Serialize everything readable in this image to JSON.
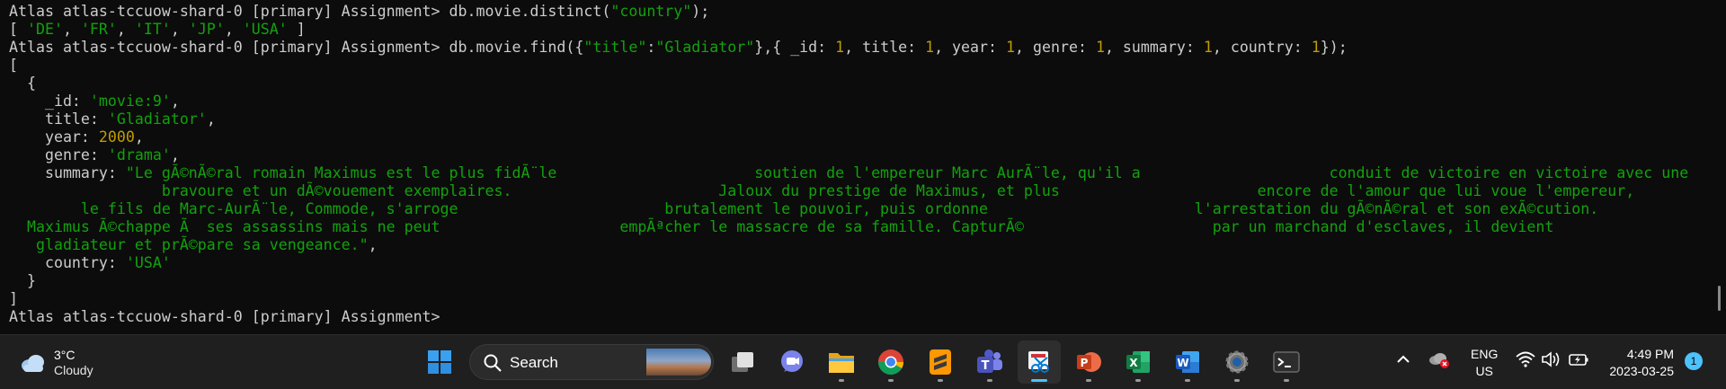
{
  "terminal": {
    "lines": [
      [
        {
          "t": "Atlas atlas-tccuow-shard-0 [primary] Assignment> db.movie.distinct("
        },
        {
          "t": "\"country\"",
          "c": "s"
        },
        {
          "t": ");"
        }
      ],
      [
        {
          "t": "[ "
        },
        {
          "t": "'DE'",
          "c": "s"
        },
        {
          "t": ", "
        },
        {
          "t": "'FR'",
          "c": "s"
        },
        {
          "t": ", "
        },
        {
          "t": "'IT'",
          "c": "s"
        },
        {
          "t": ", "
        },
        {
          "t": "'JP'",
          "c": "s"
        },
        {
          "t": ", "
        },
        {
          "t": "'USA'",
          "c": "s"
        },
        {
          "t": " ]"
        }
      ],
      [
        {
          "t": "Atlas atlas-tccuow-shard-0 [primary] Assignment> db.movie.find({"
        },
        {
          "t": "\"title\"",
          "c": "s"
        },
        {
          "t": ":"
        },
        {
          "t": "\"Gladiator\"",
          "c": "s"
        },
        {
          "t": "},{ _id: "
        },
        {
          "t": "1",
          "c": "n"
        },
        {
          "t": ", title: "
        },
        {
          "t": "1",
          "c": "n"
        },
        {
          "t": ", year: "
        },
        {
          "t": "1",
          "c": "n"
        },
        {
          "t": ", genre: "
        },
        {
          "t": "1",
          "c": "n"
        },
        {
          "t": ", summary: "
        },
        {
          "t": "1",
          "c": "n"
        },
        {
          "t": ", country: "
        },
        {
          "t": "1",
          "c": "n"
        },
        {
          "t": "});"
        }
      ],
      [
        {
          "t": "["
        }
      ],
      [
        {
          "t": "  {"
        }
      ],
      [
        {
          "t": "    _id: "
        },
        {
          "t": "'movie:9'",
          "c": "s"
        },
        {
          "t": ","
        }
      ],
      [
        {
          "t": "    title: "
        },
        {
          "t": "'Gladiator'",
          "c": "s"
        },
        {
          "t": ","
        }
      ],
      [
        {
          "t": "    year: "
        },
        {
          "t": "2000",
          "c": "n"
        },
        {
          "t": ","
        }
      ],
      [
        {
          "t": "    genre: "
        },
        {
          "t": "'drama'",
          "c": "s"
        },
        {
          "t": ","
        }
      ],
      [
        {
          "t": "    summary: "
        },
        {
          "t": "\"Le gÃ©nÃ©ral romain Maximus est le plus fidÃ¨le                      soutien de l'empereur Marc AurÃ¨le, qu'il a                     conduit de victoire en victoire avec une",
          "c": "s"
        }
      ],
      [
        {
          "t": "                 bravoure et un dÃ©vouement exemplaires.                       Jaloux du prestige de Maximus, et plus                      encore de l'amour que lui voue l'empereur,",
          "c": "s"
        }
      ],
      [
        {
          "t": "        le fils de Marc-AurÃ¨le, Commode, s'arroge                       brutalement le pouvoir, puis ordonne                       l'arrestation du gÃ©nÃ©ral et son exÃ©cution.",
          "c": "s"
        }
      ],
      [
        {
          "t": "  Maximus Ã©chappe Ã  ses assassins mais ne peut                    empÃªcher le massacre de sa famille. CapturÃ©                     par un marchand d'esclaves, il devient",
          "c": "s"
        }
      ],
      [
        {
          "t": "   gladiateur et prÃ©pare sa vengeance.\"",
          "c": "s"
        },
        {
          "t": ","
        }
      ],
      [
        {
          "t": "    country: "
        },
        {
          "t": "'USA'",
          "c": "s"
        }
      ],
      [
        {
          "t": "  }"
        }
      ],
      [
        {
          "t": "]"
        }
      ],
      [
        {
          "t": "Atlas atlas-tccuow-shard-0 [primary] Assignment>"
        }
      ]
    ]
  },
  "taskbar": {
    "weather": {
      "temp": "3°C",
      "condition": "Cloudy"
    },
    "search_label": "Search",
    "language": {
      "line1": "ENG",
      "line2": "US"
    },
    "clock": {
      "time": "4:49 PM",
      "date": "2023-03-25"
    },
    "notification_count": "1",
    "apps": [
      "task-view",
      "teams-chat",
      "file-explorer",
      "chrome",
      "sublime-text",
      "teams",
      "snipping-tool",
      "powerpoint",
      "excel",
      "word",
      "settings",
      "terminal"
    ]
  },
  "colors": {
    "terminal_bg": "#0c0c0c",
    "text": "#cccccc",
    "string": "#13a10e",
    "number": "#c19c00",
    "taskbar_bg": "#1f1f1f",
    "accent": "#4cc2ff"
  }
}
